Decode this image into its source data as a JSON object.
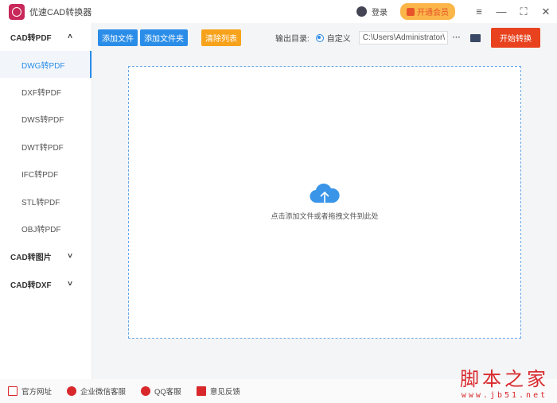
{
  "app": {
    "title": "优速CAD转换器",
    "login": "登录",
    "vip": "开通会员"
  },
  "sidebar": {
    "groups": [
      {
        "label": "CAD转PDF",
        "items": [
          "DWG转PDF",
          "DXF转PDF",
          "DWS转PDF",
          "DWT转PDF",
          "IFC转PDF",
          "STL转PDF",
          "OBJ转PDF"
        ]
      },
      {
        "label": "CAD转图片"
      },
      {
        "label": "CAD转DXF"
      }
    ]
  },
  "toolbar": {
    "add_file": "添加文件",
    "add_folder": "添加文件夹",
    "clear": "清除列表",
    "output_label": "输出目录:",
    "custom": "自定义",
    "path": "C:\\Users\\Administrator\\",
    "more": "···",
    "start": "开始转换"
  },
  "dropzone": {
    "hint": "点击添加文件或者拖拽文件到此处"
  },
  "footer": {
    "items": [
      "官方网址",
      "企业微信客服",
      "QQ客服",
      "意见反馈"
    ]
  },
  "watermark": {
    "big": "脚本之家",
    "small": "www.jb51.net"
  },
  "colors": {
    "accent": "#2a8de8",
    "start": "#e8431e",
    "clear": "#f7a21b"
  }
}
